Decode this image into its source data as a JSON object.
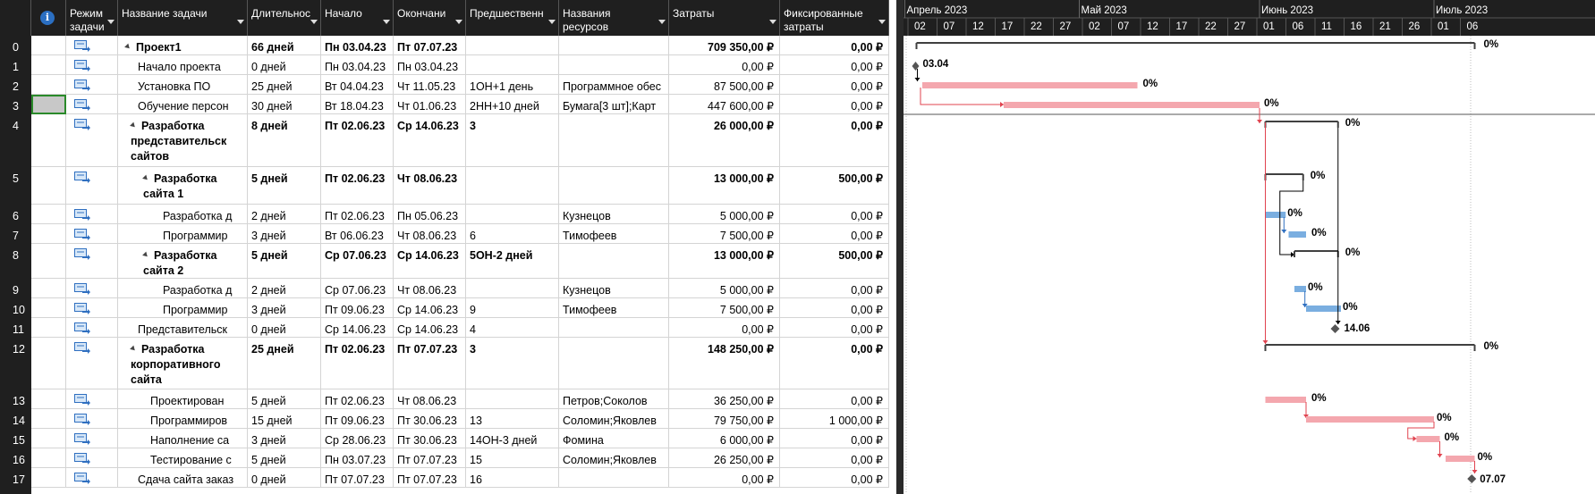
{
  "columns": {
    "indicators": "",
    "mode": "Режим\nзадачи",
    "name": "Название задачи",
    "duration": "Длительнос",
    "start": "Начало",
    "finish": "Окончани",
    "predecessors": "Предшественн",
    "resources": "Названия\nресурсов",
    "cost": "Затраты",
    "fixed_cost": "Фиксированные\nзатраты"
  },
  "rows": [
    {
      "id": "0",
      "name": "Проект1",
      "duration": "66 дней",
      "start": "Пн 03.04.23",
      "finish": "Пт 07.07.23",
      "pred": "",
      "res": "",
      "cost": "709 350,00 ₽",
      "fixed": "0,00 ₽",
      "bold": true,
      "summary": true,
      "indent": 0
    },
    {
      "id": "1",
      "name": "Начало проекта",
      "duration": "0 дней",
      "start": "Пн 03.04.23",
      "finish": "Пн 03.04.23",
      "pred": "",
      "res": "",
      "cost": "0,00 ₽",
      "fixed": "0,00 ₽",
      "indent": 1
    },
    {
      "id": "2",
      "name": "Установка ПО",
      "duration": "25 дней",
      "start": "Вт 04.04.23",
      "finish": "Чт 11.05.23",
      "pred": "1ОН+1 день",
      "res": "Программное обес",
      "cost": "87 500,00 ₽",
      "fixed": "0,00 ₽",
      "indent": 1
    },
    {
      "id": "3",
      "name": "Обучение персон",
      "duration": "30 дней",
      "start": "Вт 18.04.23",
      "finish": "Чт 01.06.23",
      "pred": "2НН+10 дней",
      "res": "Бумага[3 шт];Карт",
      "cost": "447 600,00 ₽",
      "fixed": "0,00 ₽",
      "indent": 1,
      "selected": true
    },
    {
      "id": "4",
      "name": "Разработка\nпредставительск\nсайтов",
      "duration": "8 дней",
      "start": "Пт 02.06.23",
      "finish": "Ср 14.06.23",
      "pred": "3",
      "res": "",
      "cost": "26 000,00 ₽",
      "fixed": "0,00 ₽",
      "bold": true,
      "summary": true,
      "indent": 1
    },
    {
      "id": "5",
      "name": "Разработка\nсайта 1",
      "duration": "5 дней",
      "start": "Пт 02.06.23",
      "finish": "Чт 08.06.23",
      "pred": "",
      "res": "",
      "cost": "13 000,00 ₽",
      "fixed": "500,00 ₽",
      "bold": true,
      "summary": true,
      "indent": 2
    },
    {
      "id": "6",
      "name": "Разработка д",
      "duration": "2 дней",
      "start": "Пт 02.06.23",
      "finish": "Пн 05.06.23",
      "pred": "",
      "res": "Кузнецов",
      "cost": "5 000,00 ₽",
      "fixed": "0,00 ₽",
      "indent": 3
    },
    {
      "id": "7",
      "name": "Программир",
      "duration": "3 дней",
      "start": "Вт 06.06.23",
      "finish": "Чт 08.06.23",
      "pred": "6",
      "res": "Тимофеев",
      "cost": "7 500,00 ₽",
      "fixed": "0,00 ₽",
      "indent": 3
    },
    {
      "id": "8",
      "name": "Разработка\nсайта 2",
      "duration": "5 дней",
      "start": "Ср 07.06.23",
      "finish": "Ср 14.06.23",
      "pred": "5ОН-2 дней",
      "res": "",
      "cost": "13 000,00 ₽",
      "fixed": "500,00 ₽",
      "bold": true,
      "summary": true,
      "indent": 2
    },
    {
      "id": "9",
      "name": "Разработка д",
      "duration": "2 дней",
      "start": "Ср 07.06.23",
      "finish": "Чт 08.06.23",
      "pred": "",
      "res": "Кузнецов",
      "cost": "5 000,00 ₽",
      "fixed": "0,00 ₽",
      "indent": 3
    },
    {
      "id": "10",
      "name": "Программир",
      "duration": "3 дней",
      "start": "Пт 09.06.23",
      "finish": "Ср 14.06.23",
      "pred": "9",
      "res": "Тимофеев",
      "cost": "7 500,00 ₽",
      "fixed": "0,00 ₽",
      "indent": 3
    },
    {
      "id": "11",
      "name": "Представительск",
      "duration": "0 дней",
      "start": "Ср 14.06.23",
      "finish": "Ср 14.06.23",
      "pred": "4",
      "res": "",
      "cost": "0,00 ₽",
      "fixed": "0,00 ₽",
      "indent": 1
    },
    {
      "id": "12",
      "name": "Разработка\nкорпоративного\nсайта",
      "duration": "25 дней",
      "start": "Пт 02.06.23",
      "finish": "Пт 07.07.23",
      "pred": "3",
      "res": "",
      "cost": "148 250,00 ₽",
      "fixed": "0,00 ₽",
      "bold": true,
      "summary": true,
      "indent": 1
    },
    {
      "id": "13",
      "name": "Проектирован",
      "duration": "5 дней",
      "start": "Пт 02.06.23",
      "finish": "Чт 08.06.23",
      "pred": "",
      "res": "Петров;Соколов",
      "cost": "36 250,00 ₽",
      "fixed": "0,00 ₽",
      "indent": 2
    },
    {
      "id": "14",
      "name": "Программиров",
      "duration": "15 дней",
      "start": "Пт 09.06.23",
      "finish": "Пт 30.06.23",
      "pred": "13",
      "res": "Соломин;Яковлев",
      "cost": "79 750,00 ₽",
      "fixed": "1 000,00 ₽",
      "indent": 2
    },
    {
      "id": "15",
      "name": "Наполнение са",
      "duration": "3 дней",
      "start": "Ср 28.06.23",
      "finish": "Пт 30.06.23",
      "pred": "14ОН-3 дней",
      "res": "Фомина",
      "cost": "6 000,00 ₽",
      "fixed": "0,00 ₽",
      "indent": 2
    },
    {
      "id": "16",
      "name": "Тестирование с",
      "duration": "5 дней",
      "start": "Пн 03.07.23",
      "finish": "Пт 07.07.23",
      "pred": "15",
      "res": "Соломин;Яковлев",
      "cost": "26 250,00 ₽",
      "fixed": "0,00 ₽",
      "indent": 2
    },
    {
      "id": "17",
      "name": "Сдача сайта заказ",
      "duration": "0 дней",
      "start": "Пт 07.07.23",
      "finish": "Пт 07.07.23",
      "pred": "16",
      "res": "",
      "cost": "0,00 ₽",
      "fixed": "0,00 ₽",
      "indent": 1
    }
  ],
  "timescale": {
    "months": [
      "Апрель 2023",
      "Май 2023",
      "Июнь 2023",
      "Июль 2023"
    ],
    "days": [
      "02",
      "07",
      "12",
      "17",
      "22",
      "27",
      "02",
      "07",
      "12",
      "17",
      "22",
      "27",
      "01",
      "06",
      "11",
      "16",
      "21",
      "26",
      "01",
      "06"
    ]
  },
  "gantt_labels": {
    "percent": "0%",
    "milestone_start": "03.04",
    "milestone_mid": "14.06",
    "milestone_end": "07.07"
  },
  "colors": {
    "header_bg": "#1f1f1f",
    "critical_bar": "#f4a7ae",
    "normal_bar": "#7aaee0",
    "critical_link": "#e0434f",
    "normal_link": "#2f6fc0",
    "summary": "#404040"
  }
}
